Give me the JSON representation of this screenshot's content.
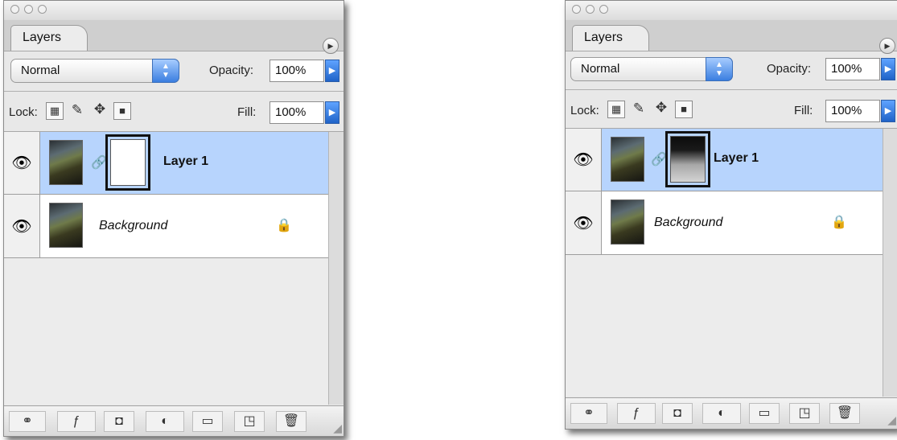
{
  "panels": [
    {
      "tab_label": "Layers",
      "blend_mode": "Normal",
      "opacity_label": "Opacity:",
      "opacity_value": "100%",
      "lock_label": "Lock:",
      "fill_label": "Fill:",
      "fill_value": "100%",
      "layers": [
        {
          "name": "Layer 1",
          "selected": true,
          "mask": "white"
        },
        {
          "name": "Background",
          "selected": false,
          "locked": true
        }
      ]
    },
    {
      "tab_label": "Layers",
      "blend_mode": "Normal",
      "opacity_label": "Opacity:",
      "opacity_value": "100%",
      "lock_label": "Lock:",
      "fill_label": "Fill:",
      "fill_value": "100%",
      "layers": [
        {
          "name": "Layer 1",
          "selected": true,
          "mask": "painted"
        },
        {
          "name": "Background",
          "selected": false,
          "locked": true
        }
      ]
    }
  ],
  "icons": {
    "panel_menu": "panel-menu-icon",
    "visibility": "eye-icon",
    "lock_transparent": "lock-transparent-pixels-icon",
    "lock_image": "lock-image-pixels-icon",
    "lock_position": "lock-position-icon",
    "lock_all": "lock-all-icon",
    "chain": "chain-link-icon",
    "footer": [
      "link-layers-icon",
      "layer-style-icon",
      "add-mask-icon",
      "adjustment-layer-icon",
      "new-group-icon",
      "new-layer-icon",
      "trash-icon"
    ]
  },
  "colors": {
    "selection": "#b7d4fd",
    "accent_blue": "#1f63c8",
    "panel_bg": "#e8e8e8"
  }
}
